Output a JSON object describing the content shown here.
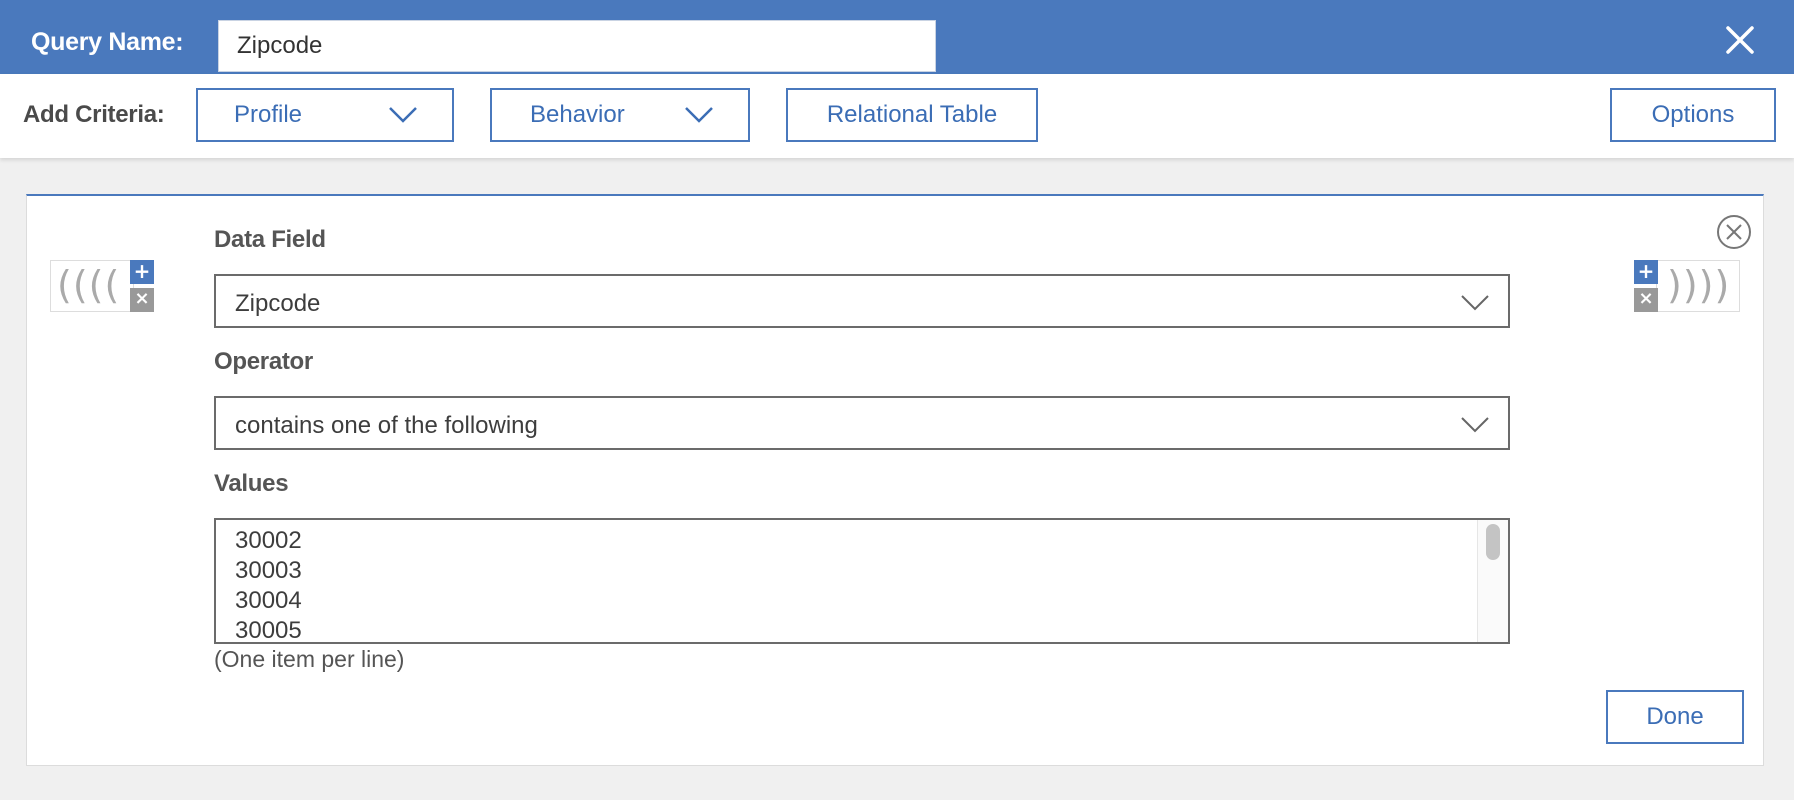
{
  "header": {
    "query_name_label": "Query Name:",
    "query_name_value": "Zipcode",
    "close_icon": "close-icon"
  },
  "criteria": {
    "label": "Add Criteria:",
    "profile_label": "Profile",
    "behavior_label": "Behavior",
    "relational_label": "Relational Table",
    "options_label": "Options"
  },
  "condition": {
    "left_parens": "((((",
    "right_parens": "))))",
    "add_symbol": "+",
    "remove_symbol": "×",
    "data_field_label": "Data Field",
    "data_field_value": "Zipcode",
    "operator_label": "Operator",
    "operator_value": "contains one of the following",
    "values_label": "Values",
    "values": [
      "30002",
      "30003",
      "30004",
      "30005"
    ],
    "hint": "(One item per line)",
    "done_label": "Done"
  },
  "colors": {
    "brand": "#4a79bd",
    "page_bg": "#f0f0f0"
  }
}
